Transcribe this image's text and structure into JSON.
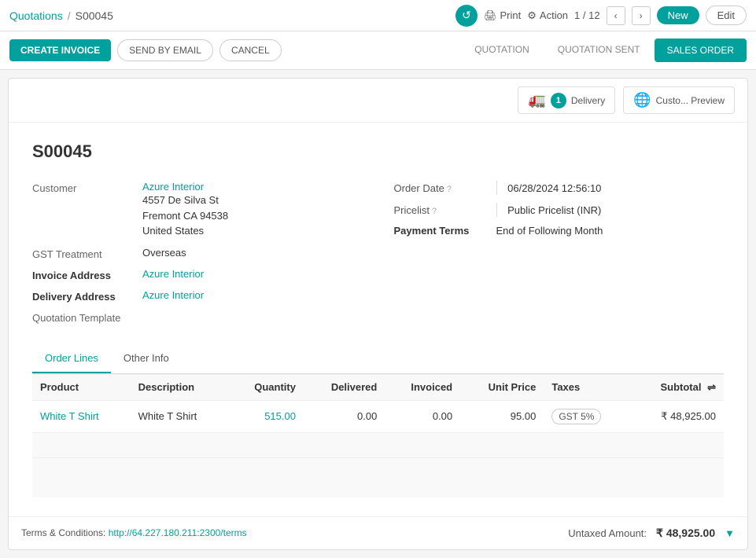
{
  "breadcrumb": {
    "parent": "Quotations",
    "separator": "/",
    "current": "S00045"
  },
  "topbar": {
    "print_label": "Print",
    "action_label": "Action",
    "counter": "1 / 12",
    "new_label": "New",
    "edit_label": "Edit",
    "sync_icon": "↺"
  },
  "actionbar": {
    "create_invoice": "CREATE INVOICE",
    "send_by_email": "SEND BY EMAIL",
    "cancel": "CANCEL"
  },
  "status_tabs": {
    "quotation": "QUOTATION",
    "quotation_sent": "QUOTATION SENT",
    "sales_order": "SALES ORDER"
  },
  "smart_buttons": {
    "delivery": {
      "count": "1",
      "label": "Delivery",
      "icon": "🚛"
    },
    "preview": {
      "label": "Custo... Preview",
      "icon": "🌐"
    }
  },
  "document": {
    "title": "S00045"
  },
  "fields": {
    "customer": {
      "label": "Customer",
      "name": "Azure Interior",
      "address_line1": "4557 De Silva St",
      "address_line2": "Fremont CA 94538",
      "address_line3": "United States"
    },
    "gst_treatment": {
      "label": "GST Treatment",
      "value": "Overseas"
    },
    "invoice_address": {
      "label": "Invoice Address",
      "value": "Azure Interior"
    },
    "delivery_address": {
      "label": "Delivery Address",
      "value": "Azure Interior"
    },
    "quotation_template": {
      "label": "Quotation Template",
      "value": ""
    },
    "order_date": {
      "label": "Order Date",
      "value": "06/28/2024 12:56:10"
    },
    "pricelist": {
      "label": "Pricelist",
      "value": "Public Pricelist (INR)"
    },
    "payment_terms": {
      "label": "Payment Terms",
      "value": "End of Following Month"
    }
  },
  "tabs": {
    "order_lines": "Order Lines",
    "other_info": "Other Info"
  },
  "table": {
    "headers": {
      "product": "Product",
      "description": "Description",
      "quantity": "Quantity",
      "delivered": "Delivered",
      "invoiced": "Invoiced",
      "unit_price": "Unit Price",
      "taxes": "Taxes",
      "subtotal": "Subtotal"
    },
    "rows": [
      {
        "product": "White T Shirt",
        "description": "White T Shirt",
        "quantity": "515.00",
        "delivered": "0.00",
        "invoiced": "0.00",
        "unit_price": "95.00",
        "taxes": "GST 5%",
        "subtotal": "₹ 48,925.00"
      }
    ]
  },
  "footer": {
    "terms_label": "Terms & Conditions:",
    "terms_link": "http://64.227.180.211:2300/terms",
    "untaxed_label": "Untaxed Amount:",
    "untaxed_value": "₹ 48,925.00"
  }
}
